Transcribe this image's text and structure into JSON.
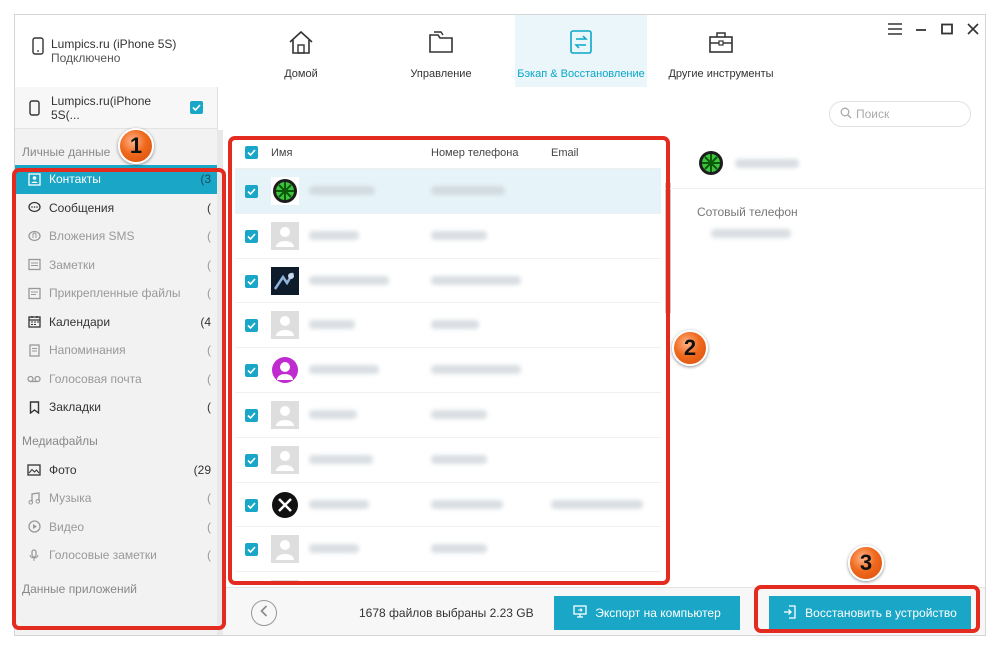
{
  "device": {
    "name": "Lumpics.ru (iPhone 5S)",
    "status": "Подключено"
  },
  "tabs": [
    {
      "label": "Домой",
      "icon": "home-icon"
    },
    {
      "label": "Управление",
      "icon": "folder-icon"
    },
    {
      "label": "Бэкап & Восстановление",
      "icon": "backup-restore-icon"
    },
    {
      "label": "Другие инструменты",
      "icon": "toolbox-icon"
    }
  ],
  "sidebar": {
    "device_label": "Lumpics.ru(iPhone 5S(...",
    "groups": {
      "personal": "Личные данные",
      "media": "Медиафайлы",
      "apps": "Данные приложений"
    },
    "items": [
      {
        "label": "Контакты",
        "count": "(3",
        "icon": "contacts-icon"
      },
      {
        "label": "Сообщения",
        "count": "(",
        "icon": "messages-icon"
      },
      {
        "label": "Вложения SMS",
        "count": "(",
        "icon": "sms-attachments-icon"
      },
      {
        "label": "Заметки",
        "count": "(",
        "icon": "notes-icon"
      },
      {
        "label": "Прикрепленные файлы",
        "count": "(",
        "icon": "attached-files-icon"
      },
      {
        "label": "Календари",
        "count": "(4",
        "icon": "calendar-icon"
      },
      {
        "label": "Напоминания",
        "count": "(",
        "icon": "reminders-icon"
      },
      {
        "label": "Голосовая почта",
        "count": "(",
        "icon": "voicemail-icon"
      },
      {
        "label": "Закладки",
        "count": "(",
        "icon": "bookmark-icon"
      },
      {
        "label": "Фото",
        "count": "(29",
        "icon": "photo-icon"
      },
      {
        "label": "Музыка",
        "count": "(",
        "icon": "music-icon"
      },
      {
        "label": "Видео",
        "count": "(",
        "icon": "video-icon"
      },
      {
        "label": "Голосовые заметки",
        "count": "(",
        "icon": "voice-memo-icon"
      }
    ]
  },
  "search": {
    "placeholder": "Поиск"
  },
  "list": {
    "columns": {
      "name": "Имя",
      "phone": "Номер телефона",
      "email": "Email"
    }
  },
  "detail": {
    "phone_label": "Сотовый телефон"
  },
  "bottom": {
    "status": "1678 файлов выбраны 2.23 GB",
    "export_label": "Экспорт на компьютер",
    "restore_label": "Восстановить в устройство"
  },
  "callouts": {
    "one": "1",
    "two": "2",
    "three": "3"
  },
  "colors": {
    "accent": "#1aa7c7",
    "highlight": "#e32b1f",
    "badge": "#f06a1d"
  }
}
